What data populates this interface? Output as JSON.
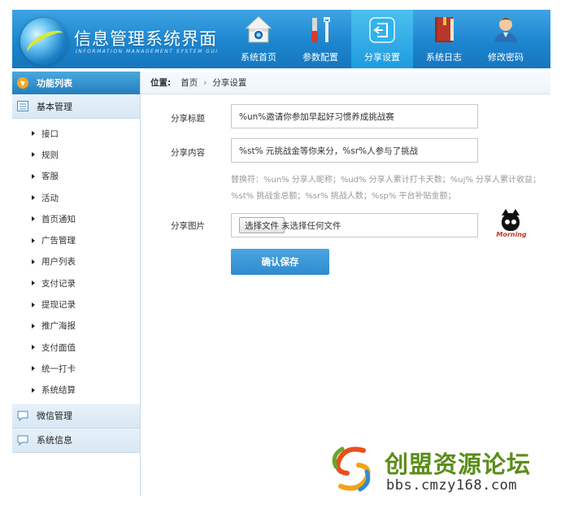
{
  "app": {
    "title": "信息管理系统界面",
    "subtitle": "INFORMATION MANAGEMENT SYSTEM GUI"
  },
  "nav": {
    "items": [
      {
        "label": "系统首页",
        "icon": "house-icon"
      },
      {
        "label": "参数配置",
        "icon": "tools-icon"
      },
      {
        "label": "分享设置",
        "icon": "share-icon",
        "active": true
      },
      {
        "label": "系统日志",
        "icon": "book-icon"
      },
      {
        "label": "修改密码",
        "icon": "user-icon"
      }
    ]
  },
  "sidebar": {
    "header": "功能列表",
    "groups": [
      {
        "label": "基本管理",
        "items": [
          "接口",
          "规则",
          "客服",
          "活动",
          "首页通知",
          "广告管理",
          "用户列表",
          "支付记录",
          "提现记录",
          "推广海报",
          "支付面值",
          "统一打卡",
          "系统结算"
        ]
      },
      {
        "label": "微信管理"
      },
      {
        "label": "系统信息"
      }
    ]
  },
  "breadcrumb": {
    "prefix": "位置:",
    "items": [
      "首页",
      "分享设置"
    ],
    "separator": "›"
  },
  "form": {
    "title_label": "分享标题",
    "title_value": "%un%邀请你参加早起好习惯养成挑战赛",
    "content_label": "分享内容",
    "content_value": "%st% 元挑战金等你来分，%sr%人参与了挑战",
    "hint_line1": "替换符：%un% 分享人昵称；%ud% 分享人累计打卡天数；%uj% 分享人累计收益；",
    "hint_line2": "%st% 挑战金总额；%sr% 挑战人数；%sp% 平台补贴金额；",
    "image_label": "分享图片",
    "file_button": "选择文件",
    "file_status": "未选择任何文件",
    "thumb_caption": "Morning",
    "save_button": "确认保存"
  },
  "watermark": {
    "title": "创盟资源论坛",
    "url": "bbs.cmzy168.com"
  },
  "colors": {
    "header_blue": "#1c86cf",
    "nav_active": "#1e9bdf",
    "button_blue": "#2f8bd0",
    "sidebar_group_bg": "#dde9f4",
    "watermark_green": "#5b8d1a"
  }
}
